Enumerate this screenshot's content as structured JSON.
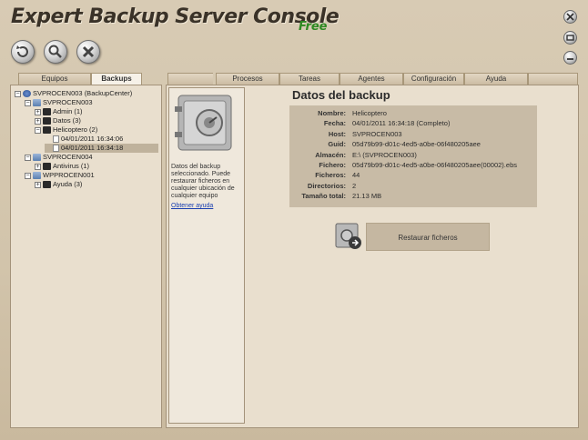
{
  "window": {
    "title": "Expert Backup Server Console",
    "edition": "Free"
  },
  "toolbar": {
    "buttons": [
      {
        "icon": "refresh-icon"
      },
      {
        "icon": "search-icon"
      },
      {
        "icon": "close-icon"
      }
    ]
  },
  "left_tabs": [
    "Equipos",
    "Backups"
  ],
  "left_active_tab": "Backups",
  "tree": [
    {
      "label": "SVPROCEN003 (BackupCenter)",
      "level": 0,
      "icon": "network-icon",
      "expander": "−"
    },
    {
      "label": "SVPROCEN003",
      "level": 1,
      "icon": "server-icon",
      "expander": "−"
    },
    {
      "label": "Admin (1)",
      "level": 2,
      "icon": "disk-icon",
      "expander": "+"
    },
    {
      "label": "Datos (3)",
      "level": 2,
      "icon": "disk-icon",
      "expander": "+"
    },
    {
      "label": "Helicoptero (2)",
      "level": 2,
      "icon": "disk-icon",
      "expander": "−"
    },
    {
      "label": "04/01/2011 16:34:06",
      "level": 3,
      "icon": "doc-icon",
      "expander": ""
    },
    {
      "label": "04/01/2011 16:34:18",
      "level": 3,
      "icon": "doc-icon",
      "expander": "",
      "selected": true
    },
    {
      "label": "SVPROCEN004",
      "level": 1,
      "icon": "server-icon",
      "expander": "−"
    },
    {
      "label": "Antivirus (1)",
      "level": 2,
      "icon": "disk-icon",
      "expander": "+"
    },
    {
      "label": "WPPROCEN001",
      "level": 1,
      "icon": "server-icon",
      "expander": "−"
    },
    {
      "label": "Ayuda (3)",
      "level": 2,
      "icon": "disk-icon",
      "expander": "+"
    }
  ],
  "main_tabs": [
    "Procesos",
    "Tareas",
    "Agentes",
    "Configuración",
    "Ayuda"
  ],
  "side_info": {
    "description": "Datos del backup seleccionado. Puede restaurar ficheros en cualquier ubicación de cualquier equipo",
    "help_link": "Obtener ayuda"
  },
  "details": {
    "heading": "Datos del backup",
    "rows": [
      {
        "key": "Nombre:",
        "value": "Helicoptero"
      },
      {
        "key": "Fecha:",
        "value": "04/01/2011 16:34:18 (Completo)"
      },
      {
        "key": "Host:",
        "value": "SVPROCEN003"
      },
      {
        "key": "Guid:",
        "value": "05d79b99-d01c-4ed5-a0be-06f480205aee"
      },
      {
        "key": "Almacén:",
        "value": "E:\\ (SVPROCEN003)"
      },
      {
        "key": "Fichero:",
        "value": "05d79b99-d01c-4ed5-a0be-06f480205aee(00002).ebs"
      },
      {
        "key": "Ficheros:",
        "value": "44"
      },
      {
        "key": "Directorios:",
        "value": "2"
      },
      {
        "key": "Tamaño total:",
        "value": "21.13 MB"
      }
    ]
  },
  "restore_button": {
    "label": "Restaurar ficheros"
  }
}
